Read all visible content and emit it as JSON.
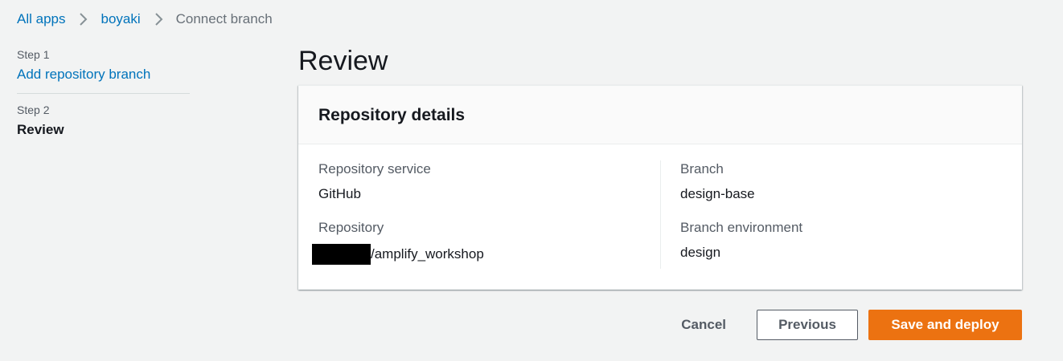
{
  "breadcrumb": {
    "items": [
      {
        "label": "All apps"
      },
      {
        "label": "boyaki"
      },
      {
        "label": "Connect branch"
      }
    ],
    "separator_icon": "chevron-right-icon"
  },
  "steps": [
    {
      "number": "Step 1",
      "label": "Add repository branch"
    },
    {
      "number": "Step 2",
      "label": "Review"
    }
  ],
  "main": {
    "title": "Review",
    "panel": {
      "title": "Repository details",
      "left": [
        {
          "label": "Repository service",
          "value": "GitHub"
        },
        {
          "label": "Repository",
          "value": "/amplify_workshop"
        }
      ],
      "right": [
        {
          "label": "Branch",
          "value": "design-base"
        },
        {
          "label": "Branch environment",
          "value": "design"
        }
      ]
    }
  },
  "actions": {
    "cancel_label": "Cancel",
    "previous_label": "Previous",
    "primary_label": "Save and deploy"
  },
  "colors": {
    "link": "#0073bb",
    "primary": "#ec7211",
    "background": "#f2f3f3"
  }
}
